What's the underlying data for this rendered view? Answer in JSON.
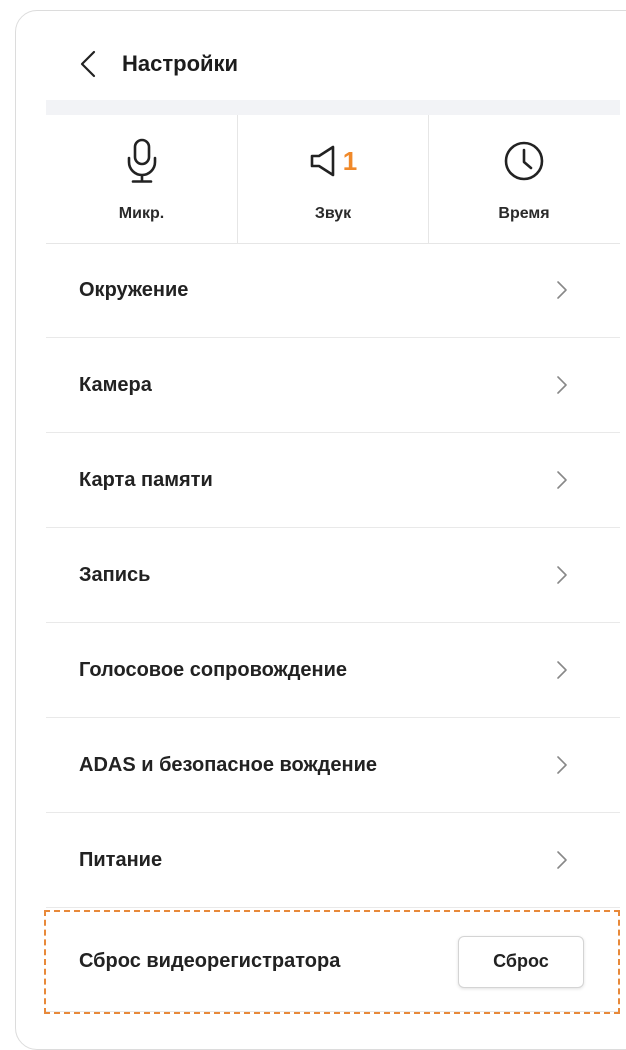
{
  "header": {
    "title": "Настройки",
    "back_icon": "chevron-left-icon"
  },
  "quick_settings": {
    "mic": {
      "label": "Микр.",
      "icon": "microphone-icon"
    },
    "sound": {
      "label": "Звук",
      "icon": "speaker-icon",
      "value": "1"
    },
    "time": {
      "label": "Время",
      "icon": "clock-icon"
    }
  },
  "menu": {
    "items": [
      {
        "label": "Окружение"
      },
      {
        "label": "Камера"
      },
      {
        "label": "Карта памяти"
      },
      {
        "label": "Запись"
      },
      {
        "label": "Голосовое сопровождение"
      },
      {
        "label": "ADAS и безопасное вождение"
      },
      {
        "label": "Питание"
      }
    ]
  },
  "reset": {
    "label": "Сброс видеорегистратора",
    "button_label": "Сброс"
  },
  "colors": {
    "accent": "#f0892a",
    "highlight_border": "#e8893a",
    "band": "#f2f3f6"
  }
}
